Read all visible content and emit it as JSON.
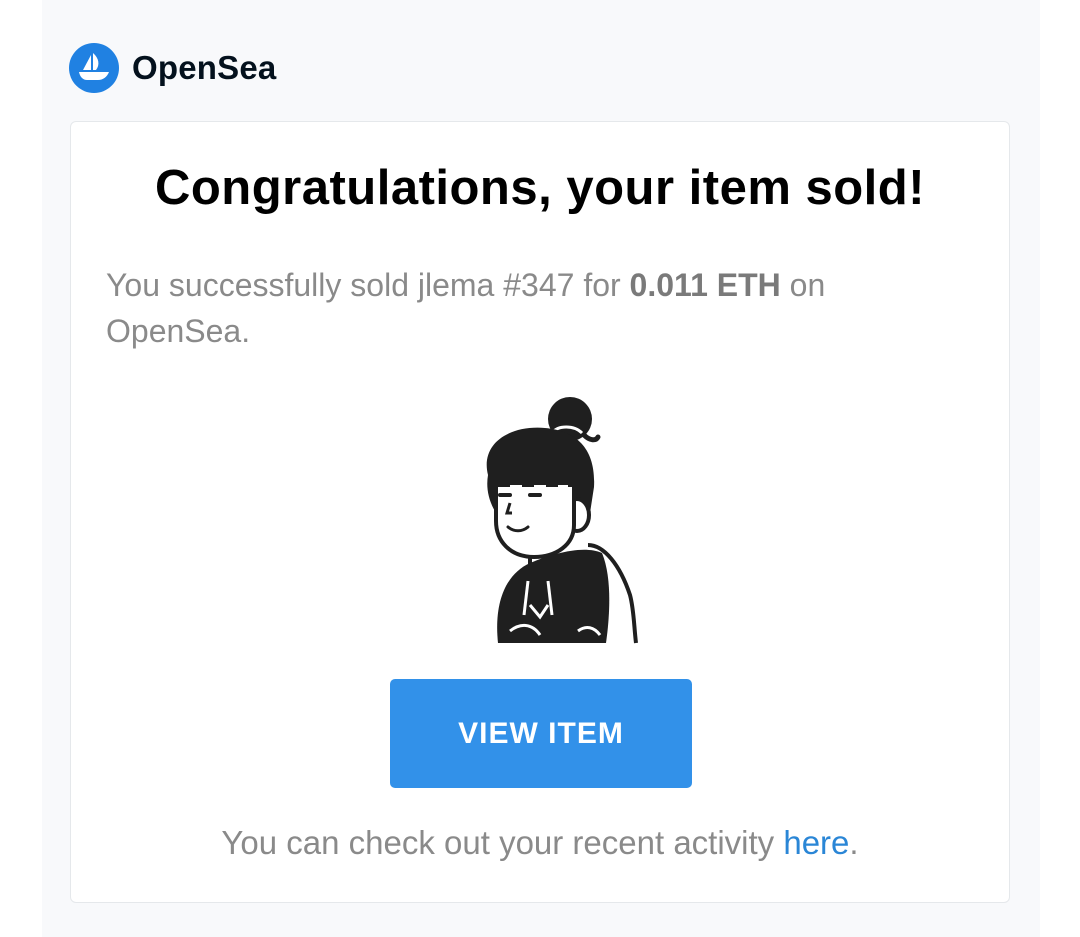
{
  "brand": {
    "name": "OpenSea",
    "logo_icon": "opensea-ship-icon",
    "logo_color": "#2081e2"
  },
  "card": {
    "headline": "Congratulations, your item sold!",
    "message": {
      "prefix": "You successfully sold jlema #347 for ",
      "price": "0.011 ETH",
      "suffix": " on OpenSea."
    },
    "item_image": "nft-character-illustration",
    "button_label": "VIEW ITEM",
    "button_color": "#3291e9",
    "footer": {
      "prefix": "You can check out your recent activity ",
      "link_label": "here",
      "suffix": "."
    }
  }
}
